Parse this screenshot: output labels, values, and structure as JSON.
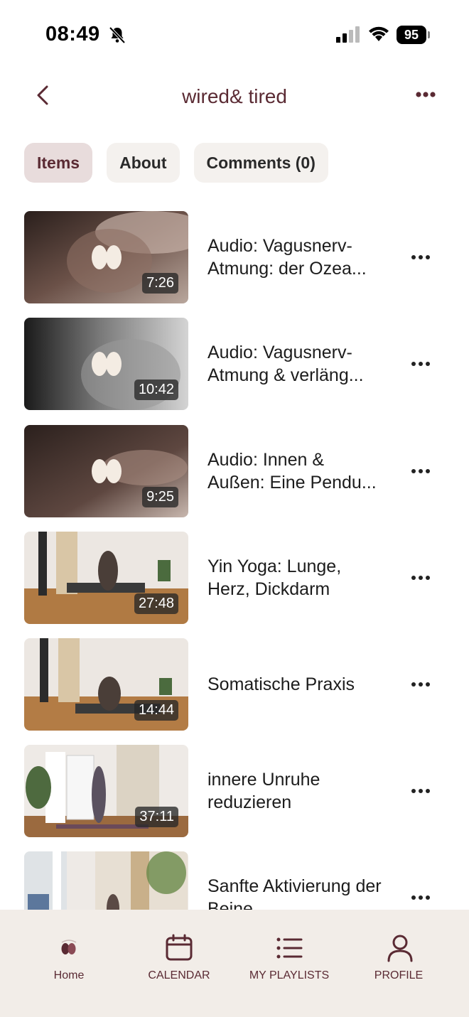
{
  "status_bar": {
    "time": "08:49",
    "battery": "95"
  },
  "header": {
    "title": "wired& tired"
  },
  "tabs": [
    {
      "label": "Items",
      "active": true
    },
    {
      "label": "About",
      "active": false
    },
    {
      "label": "Comments (0)",
      "active": false
    }
  ],
  "items": [
    {
      "title": "Audio: Vagusnerv-Atmung: der Ozea...",
      "duration": "7:26"
    },
    {
      "title": "Audio: Vagusnerv-Atmung & verläng...",
      "duration": "10:42"
    },
    {
      "title": "Audio: Innen & Außen: Eine Pendu...",
      "duration": "9:25"
    },
    {
      "title": "Yin Yoga:  Lunge, Herz, Dickdarm",
      "duration": "27:48"
    },
    {
      "title": "Somatische Praxis",
      "duration": "14:44"
    },
    {
      "title": "innere Unruhe reduzieren",
      "duration": "37:11"
    },
    {
      "title": "Sanfte Aktivierung der Beine",
      "duration": ""
    }
  ],
  "bottom_nav": [
    {
      "label": "Home",
      "icon": "home-logo-icon"
    },
    {
      "label": "CALENDAR",
      "icon": "calendar-icon"
    },
    {
      "label": "MY PLAYLISTS",
      "icon": "list-icon"
    },
    {
      "label": "PROFILE",
      "icon": "profile-icon"
    }
  ],
  "colors": {
    "accent": "#5a2a33",
    "nav_bg": "#f2ede8",
    "tab_active_bg": "#e8dcdc",
    "tab_bg": "#f4f1ee"
  }
}
